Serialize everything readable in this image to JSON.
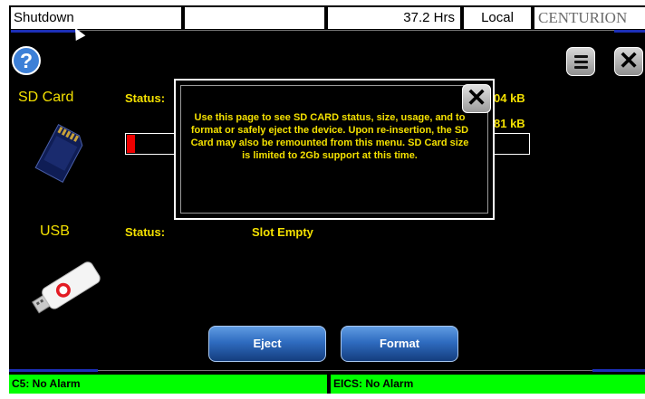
{
  "topbar": {
    "title": "Shutdown",
    "hours": "37.2 Hrs",
    "mode": "Local",
    "brand": "CENTURION"
  },
  "icons": {
    "help": "question-icon",
    "menu": "menu-icon",
    "close": "close-icon"
  },
  "sd_card": {
    "label": "SD Card",
    "status_label": "Status:",
    "size_used": "04 kB",
    "size_total": "81 kB",
    "usage_fraction": 0.03
  },
  "usb": {
    "label": "USB",
    "status_label": "Status:",
    "status_value": "Slot Empty"
  },
  "dialog": {
    "text": "Use this page to see SD CARD status, size, usage, and to format or safely eject the device.  Upon re-insertion, the SD Card may also be remounted from this menu.  SD Card size is limited to 2Gb support at this time.",
    "close_label": "✕"
  },
  "buttons": {
    "eject": "Eject",
    "format": "Format"
  },
  "alarms": {
    "left": "C5: No Alarm",
    "right": "EICS: No Alarm"
  },
  "colors": {
    "accent_text": "#f3e000",
    "alarm_bg": "#00ff00",
    "button_blue": "#2f6cc0"
  }
}
